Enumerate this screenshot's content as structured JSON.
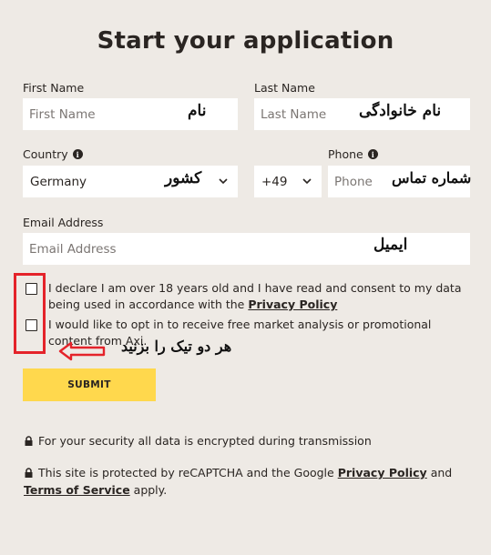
{
  "form": {
    "title": "Start your application",
    "first_name": {
      "label": "First Name",
      "placeholder": "First Name",
      "note": "نام"
    },
    "last_name": {
      "label": "Last Name",
      "placeholder": "Last Name",
      "note": "نام خانوادگی"
    },
    "country": {
      "label": "Country",
      "value": "Germany",
      "note": "کشور"
    },
    "phone_code": {
      "value": "+49"
    },
    "phone": {
      "label": "Phone",
      "placeholder": "Phone",
      "note": "شماره تماس"
    },
    "email": {
      "label": "Email Address",
      "placeholder": "Email Address",
      "note": "ایمیل"
    },
    "consent1": {
      "text": "I declare I am over 18 years old and I have read and consent to my data being used in accordance with the",
      "link": "Privacy Policy"
    },
    "consent2": {
      "text": "I would like to opt in to receive free market analysis or promotional content from Axi."
    },
    "checkbox_note": "هر دو تیک را بزنید",
    "submit_label": "SUBMIT"
  },
  "security": {
    "line1": "For your security all data is encrypted during transmission",
    "line2_pre": "This site is protected by reCAPTCHA and the Google",
    "privacy_link": "Privacy Policy",
    "and": "and",
    "terms_link": "Terms of Service",
    "line2_post": "apply."
  },
  "colors": {
    "background": "#eeeae5",
    "submit": "#ffd84d",
    "annotation_red": "#e4232a"
  },
  "icons": [
    "info-icon",
    "chevron-down-icon",
    "lock-icon",
    "arrow-left-icon"
  ]
}
